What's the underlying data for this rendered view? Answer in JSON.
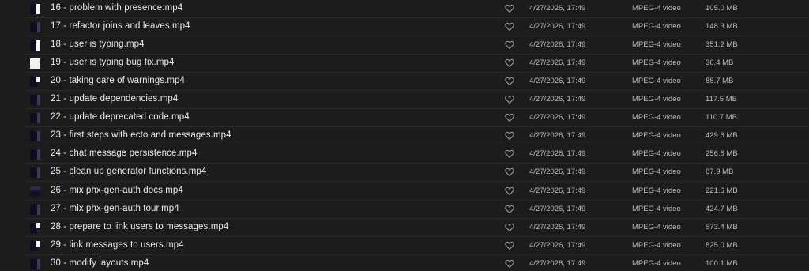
{
  "colors": {
    "background": "#1c1c1c",
    "divider": "#2a2a2a",
    "name_text": "#ebebeb",
    "meta_text": "#bdbdbd"
  },
  "files": [
    {
      "name": "16 - problem with presence.mp4",
      "date": "4/27/2026, 17:49",
      "kind": "MPEG-4 video",
      "size": "105.0 MB",
      "icon": "video-thumbnail-icon",
      "favorite_icon": "heart-icon"
    },
    {
      "name": "17 - refactor joins and leaves.mp4",
      "date": "4/27/2026, 17:49",
      "kind": "MPEG-4 video",
      "size": "148.3 MB",
      "icon": "video-thumbnail-icon",
      "favorite_icon": "heart-icon"
    },
    {
      "name": "18 - user is typing.mp4",
      "date": "4/27/2026, 17:49",
      "kind": "MPEG-4 video",
      "size": "351.2 MB",
      "icon": "video-thumbnail-icon",
      "favorite_icon": "heart-icon"
    },
    {
      "name": "19 - user is typing bug fix.mp4",
      "date": "4/27/2026, 17:49",
      "kind": "MPEG-4 video",
      "size": "36.4 MB",
      "icon": "video-thumbnail-icon",
      "favorite_icon": "heart-icon"
    },
    {
      "name": "20 - taking care of warnings.mp4",
      "date": "4/27/2026, 17:49",
      "kind": "MPEG-4 video",
      "size": "88.7 MB",
      "icon": "video-thumbnail-icon",
      "favorite_icon": "heart-icon"
    },
    {
      "name": "21 - update dependencies.mp4",
      "date": "4/27/2026, 17:49",
      "kind": "MPEG-4 video",
      "size": "117.5 MB",
      "icon": "video-thumbnail-icon",
      "favorite_icon": "heart-icon"
    },
    {
      "name": "22 - update deprecated code.mp4",
      "date": "4/27/2026, 17:49",
      "kind": "MPEG-4 video",
      "size": "110.7 MB",
      "icon": "video-thumbnail-icon",
      "favorite_icon": "heart-icon"
    },
    {
      "name": "23 - first steps with ecto and messages.mp4",
      "date": "4/27/2026, 17:49",
      "kind": "MPEG-4 video",
      "size": "429.6 MB",
      "icon": "video-thumbnail-icon",
      "favorite_icon": "heart-icon"
    },
    {
      "name": "24 - chat message persistence.mp4",
      "date": "4/27/2026, 17:49",
      "kind": "MPEG-4 video",
      "size": "256.6 MB",
      "icon": "video-thumbnail-icon",
      "favorite_icon": "heart-icon"
    },
    {
      "name": "25 - clean up generator functions.mp4",
      "date": "4/27/2026, 17:49",
      "kind": "MPEG-4 video",
      "size": "87.9 MB",
      "icon": "video-thumbnail-icon",
      "favorite_icon": "heart-icon"
    },
    {
      "name": "26 - mix phx-gen-auth docs.mp4",
      "date": "4/27/2026, 17:49",
      "kind": "MPEG-4 video",
      "size": "221.6 MB",
      "icon": "video-thumbnail-icon",
      "favorite_icon": "heart-icon"
    },
    {
      "name": "27 - mix phx-gen-auth tour.mp4",
      "date": "4/27/2026, 17:49",
      "kind": "MPEG-4 video",
      "size": "424.7 MB",
      "icon": "video-thumbnail-icon",
      "favorite_icon": "heart-icon"
    },
    {
      "name": "28 - prepare to link users to messages.mp4",
      "date": "4/27/2026, 17:49",
      "kind": "MPEG-4 video",
      "size": "573.4 MB",
      "icon": "video-thumbnail-icon",
      "favorite_icon": "heart-icon"
    },
    {
      "name": "29 - link messages to users.mp4",
      "date": "4/27/2026, 17:49",
      "kind": "MPEG-4 video",
      "size": "825.0 MB",
      "icon": "video-thumbnail-icon",
      "favorite_icon": "heart-icon"
    },
    {
      "name": "30 - modify layouts.mp4",
      "date": "4/27/2026, 17:49",
      "kind": "MPEG-4 video",
      "size": "100.1 MB",
      "icon": "video-thumbnail-icon",
      "favorite_icon": "heart-icon"
    }
  ]
}
